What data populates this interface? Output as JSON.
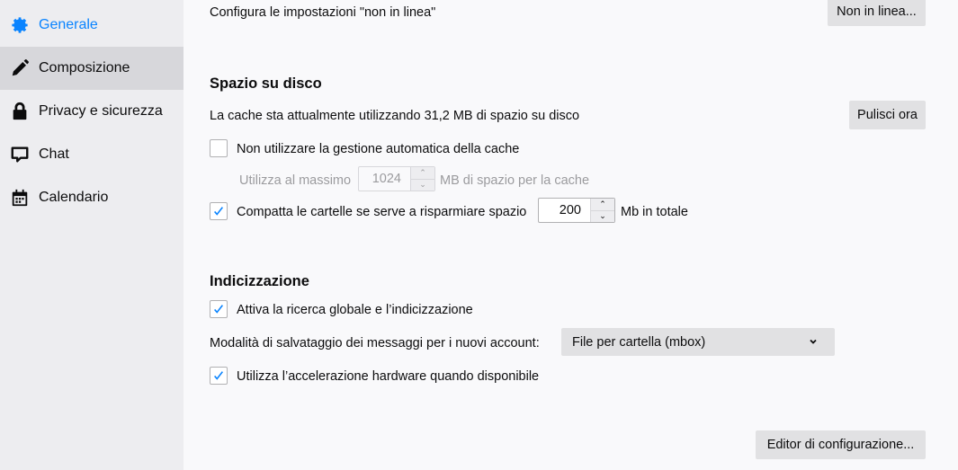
{
  "sidebar": {
    "items": [
      {
        "label": "Generale",
        "icon": "gear-icon",
        "active": true
      },
      {
        "label": "Composizione",
        "icon": "pencil-icon",
        "hovered": true
      },
      {
        "label": "Privacy e sicurezza",
        "icon": "lock-icon"
      },
      {
        "label": "Chat",
        "icon": "chat-icon"
      },
      {
        "label": "Calendario",
        "icon": "calendar-icon"
      }
    ]
  },
  "offline": {
    "label": "Configura le impostazioni \"non in linea\"",
    "button": "Non in linea..."
  },
  "disk": {
    "heading": "Spazio su disco",
    "cache_usage": "La cache sta attualmente utilizzando 31,2 MB di spazio su disco",
    "clear_button": "Pulisci ora",
    "override_cache_label": "Non utilizzare la gestione automatica della cache",
    "override_cache_checked": false,
    "max_cache_prefix": "Utilizza al massimo",
    "max_cache_value": "1024",
    "max_cache_suffix": "MB di spazio per la cache",
    "compact_label": "Compatta le cartelle se serve a risparmiare spazio",
    "compact_checked": true,
    "compact_value": "200",
    "compact_suffix": "Mb in totale"
  },
  "indexing": {
    "heading": "Indicizzazione",
    "global_search_label": "Attiva la ricerca globale e l’indicizzazione",
    "global_search_checked": true,
    "store_type_label": "Modalità di salvataggio dei messaggi per i nuovi account:",
    "store_type_value": "File per cartella (mbox)",
    "hw_accel_label": "Utilizza l’accelerazione hardware quando disponibile",
    "hw_accel_checked": true
  },
  "config_editor_button": "Editor di configurazione...",
  "colors": {
    "accent": "#0a84ff",
    "checkmark": "#0a84ff"
  }
}
